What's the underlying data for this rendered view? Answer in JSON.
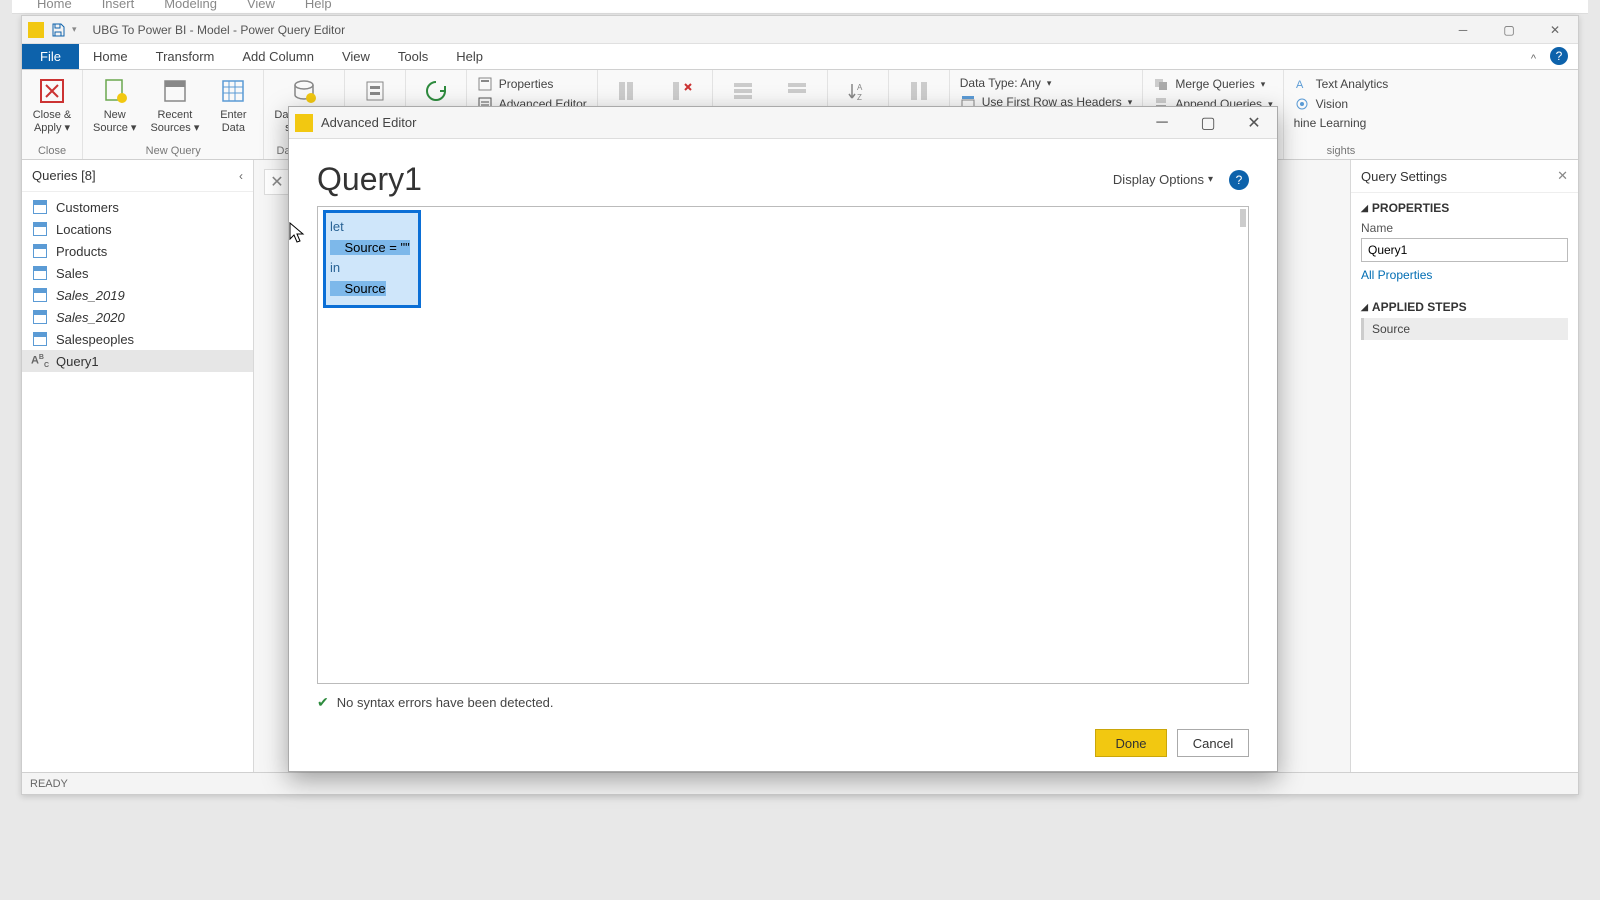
{
  "partialTop": [
    "Home",
    "Insert",
    "Modeling",
    "View",
    "Help"
  ],
  "titlebar": {
    "title": "UBG To Power BI - Model - Power Query Editor"
  },
  "ribbonTabs": {
    "file": "File",
    "tabs": [
      "Home",
      "Transform",
      "Add Column",
      "View",
      "Tools",
      "Help"
    ],
    "active": "Home"
  },
  "ribbon": {
    "close": {
      "btn": "Close &\nApply",
      "group": "Close"
    },
    "newQuery": {
      "new": "New\nSource",
      "recent": "Recent\nSources",
      "enter": "Enter\nData",
      "group": "New Query"
    },
    "dataSources": {
      "settings": "Data source\nsettings",
      "group": "Data Sourc"
    },
    "manage": {
      "properties": "Properties",
      "advEditor": "Advanced Editor"
    },
    "transform": {
      "dataType": "Data Type: Any",
      "firstRow": "Use First Row as Headers"
    },
    "combine": {
      "merge": "Merge Queries",
      "append": "Append Queries"
    },
    "ai": {
      "textAnalytics": "Text Analytics",
      "vision": "Vision",
      "ml": "hine Learning",
      "group": "sights"
    }
  },
  "queriesPanel": {
    "header": "Queries [8]",
    "items": [
      {
        "label": "Customers",
        "type": "table"
      },
      {
        "label": "Locations",
        "type": "table"
      },
      {
        "label": "Products",
        "type": "table"
      },
      {
        "label": "Sales",
        "type": "table"
      },
      {
        "label": "Sales_2019",
        "type": "table",
        "italic": true
      },
      {
        "label": "Sales_2020",
        "type": "table",
        "italic": true
      },
      {
        "label": "Salespeoples",
        "type": "table"
      },
      {
        "label": "Query1",
        "type": "abc",
        "selected": true
      }
    ]
  },
  "settingsPanel": {
    "header": "Query Settings",
    "propsTitle": "PROPERTIES",
    "nameLabel": "Name",
    "nameValue": "Query1",
    "allProps": "All Properties",
    "stepsTitle": "APPLIED STEPS",
    "steps": [
      "Source"
    ]
  },
  "statusbar": {
    "left": "READY"
  },
  "modal": {
    "title": "Advanced Editor",
    "queryName": "Query1",
    "displayOptions": "Display Options",
    "code": {
      "l1": "let",
      "l2": "    Source = \"\"",
      "l3": "in",
      "l4": "    Source"
    },
    "status": "No syntax errors have been detected.",
    "done": "Done",
    "cancel": "Cancel"
  }
}
